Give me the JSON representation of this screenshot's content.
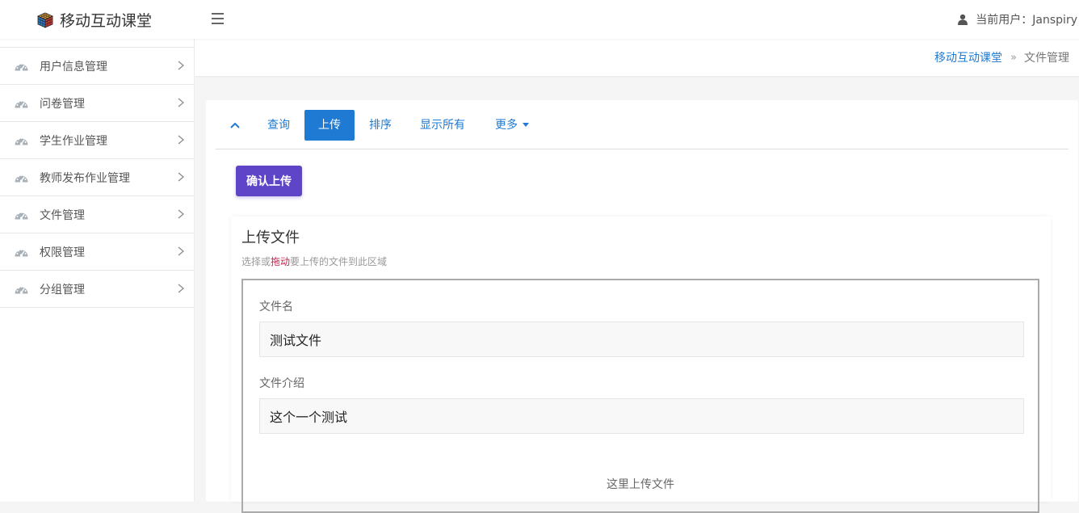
{
  "app": {
    "title": "移动互动课堂"
  },
  "user": {
    "label": "当前用户：Janspiry"
  },
  "sidebar": {
    "items": [
      {
        "label": "用户信息管理"
      },
      {
        "label": "问卷管理"
      },
      {
        "label": "学生作业管理"
      },
      {
        "label": "教师发布作业管理"
      },
      {
        "label": "文件管理"
      },
      {
        "label": "权限管理"
      },
      {
        "label": "分组管理"
      }
    ]
  },
  "breadcrumb": {
    "home": "移动互动课堂",
    "current": "文件管理"
  },
  "toolbar": {
    "tabs": [
      {
        "label": "查询"
      },
      {
        "label": "上传"
      },
      {
        "label": "排序"
      },
      {
        "label": "显示所有"
      },
      {
        "label": "更多"
      }
    ],
    "active_tab": "上传"
  },
  "confirm_button": "确认上传",
  "upload": {
    "title": "上传文件",
    "hint_before": "选择或",
    "hint_emphasis": "拖动",
    "hint_after": "要上传的文件到此区域",
    "file_name_label": "文件名",
    "file_name_value": "测试文件",
    "file_desc_label": "文件介绍",
    "file_desc_value": "这个一个测试",
    "drop_text": "这里上传文件"
  },
  "colors": {
    "primary": "#1e7ad2",
    "confirm": "#5e45c8",
    "hint_emphasis": "#c7254e"
  }
}
